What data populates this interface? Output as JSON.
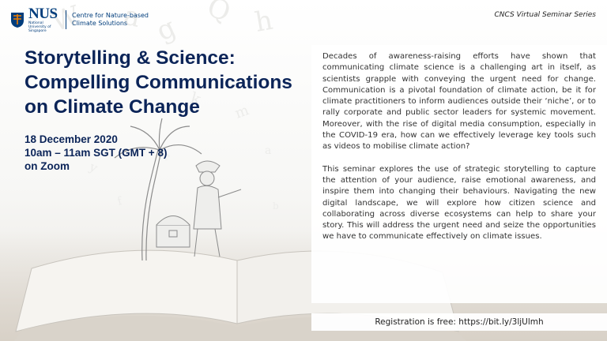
{
  "header": {
    "logo_wordmark": "NUS",
    "logo_subtext": "National University of Singapore",
    "centre_name_line1": "Centre for Nature-based",
    "centre_name_line2": "Climate Solutions",
    "series": "CNCS Virtual Seminar Series"
  },
  "event": {
    "title_lines": [
      "Storytelling & Science:",
      "Compelling Communications",
      "on Climate Change"
    ],
    "date": "18 December 2020",
    "time": "10am – 11am SGT (GMT + 8)",
    "platform": "on Zoom"
  },
  "description": {
    "paragraph1": "Decades of awareness-raising efforts have shown that communicating climate science is a challenging art in itself, as scientists grapple with conveying the urgent need for change. Communication is a pivotal foundation of climate action, be it for climate practitioners to inform audiences outside their ‘niche’, or to rally corporate and public sector leaders for systemic movement. Moreover, with the rise of digital media consumption, especially in the COVID-19 era, how can we effectively leverage key tools such as videos to mobilise climate action?",
    "paragraph2": "This seminar explores the use of strategic storytelling to capture the attention of your audience, raise emotional awareness, and inspire them into changing their behaviours. Navigating the new digital landscape, we will explore how citizen science and collaborating across diverse ecosystems can help to share your story. This will address the urgent need and seize the opportunities we have to communicate effectively on climate issues."
  },
  "registration": {
    "text": "Registration is free: https://bit.ly/3ljUlmh"
  },
  "colors": {
    "title": "#0b2458",
    "nus_blue": "#003d7c",
    "nus_orange": "#ef7c00"
  }
}
